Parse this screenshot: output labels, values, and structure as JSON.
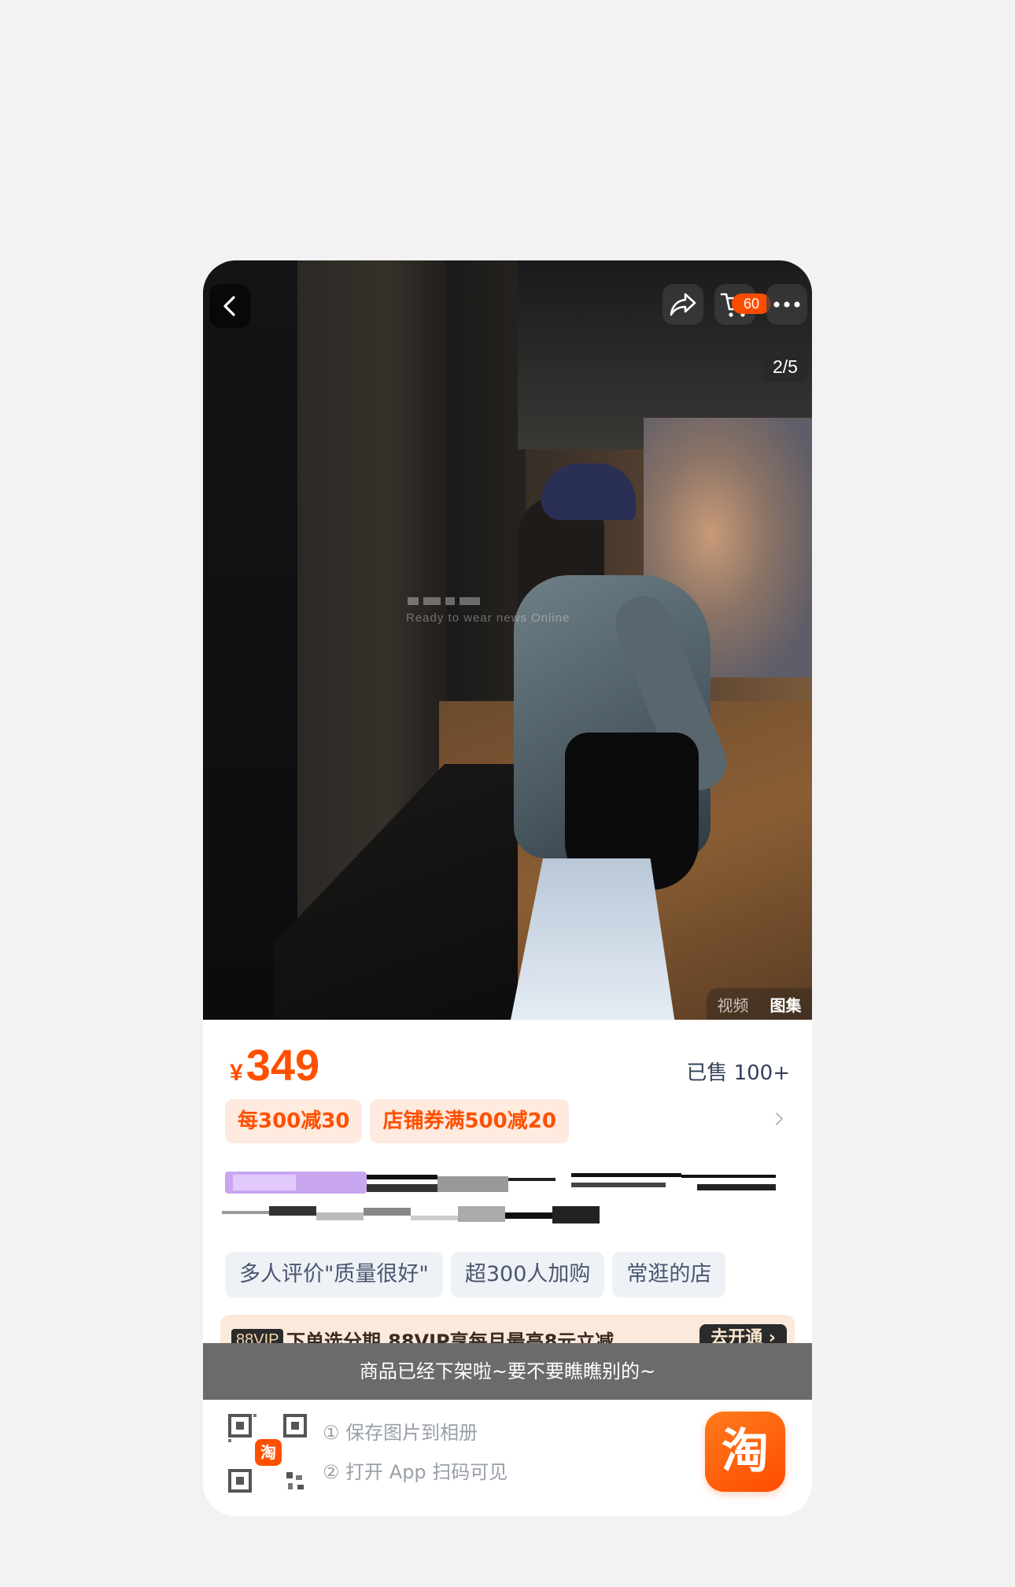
{
  "header": {
    "cart_badge": "60",
    "page_indicator": "2/5",
    "icons": [
      "back-arrow-icon",
      "share-icon",
      "cart-icon",
      "more-icon"
    ]
  },
  "media": {
    "watermark": "Ready to wear news Online",
    "video_label": "视频",
    "gallery_label": "图集"
  },
  "product": {
    "currency": "¥",
    "price": "349",
    "sold": "已售 100+",
    "coupons": [
      "每300减30",
      "店铺券满500减20"
    ],
    "tags": [
      "多人评价\"质量很好\"",
      "超300人加购",
      "常逛的店"
    ]
  },
  "vip": {
    "badge": "88VIP",
    "text": "下单选分期,88VIP享每月最高8元立减",
    "action": "去开通 ›"
  },
  "status": {
    "offline_message": "商品已经下架啦~要不要瞧瞧别的~"
  },
  "footer": {
    "qr_logo": "淘",
    "step1": "① 保存图片到相册",
    "step2": "② 打开 App 扫码可见",
    "app_logo": "淘"
  },
  "colors": {
    "accent": "#ff5000",
    "coupon_bg": "#ffeadf",
    "tag_bg": "#eef1f6",
    "banner_bg": "#6b6b6b"
  }
}
